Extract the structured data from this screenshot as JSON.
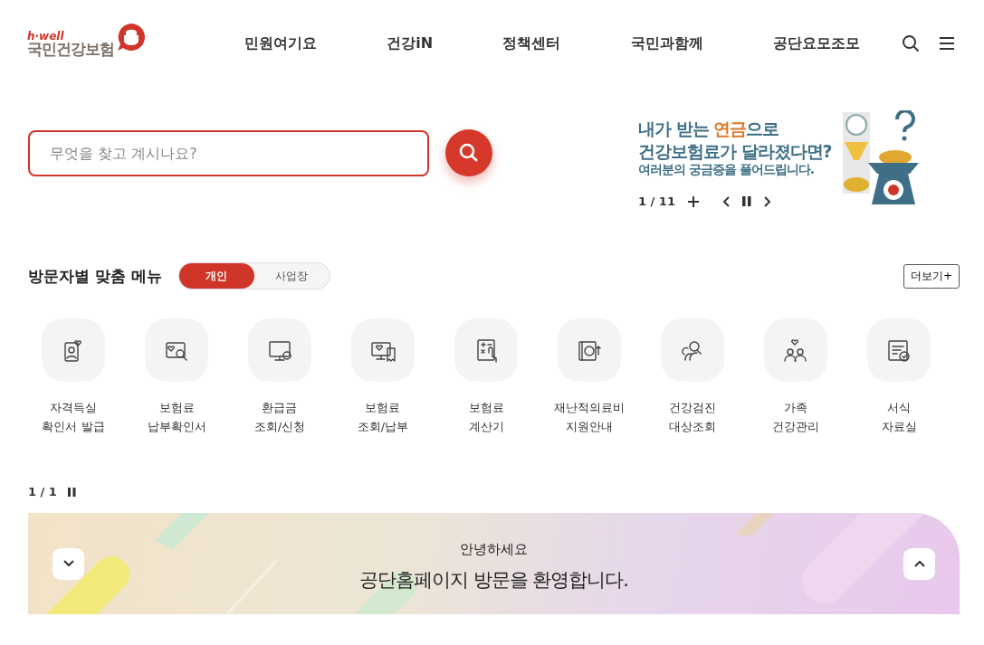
{
  "header": {
    "logo_tagline": "h·well",
    "logo_name": "국민건강보험",
    "nav": [
      {
        "label": "민원여기요"
      },
      {
        "label": "건강iN"
      },
      {
        "label": "정책센터"
      },
      {
        "label": "국민과함께"
      },
      {
        "label": "공단요모조모"
      }
    ]
  },
  "search": {
    "placeholder": "무엇을 찾고 계시나요?"
  },
  "promo": {
    "headline_1": [
      {
        "text": "내가 받는 ",
        "highlight": false
      },
      {
        "text": "연금",
        "highlight": true
      },
      {
        "text": "으로",
        "highlight": false
      }
    ],
    "headline_2": "건강보험료가 달라졌다면?",
    "subtitle": "여러분의 궁금증을 풀어드립니다.",
    "counter": "1 / 11",
    "paused": true
  },
  "menu": {
    "title": "방문자별 맞춤 메뉴",
    "tabs": [
      {
        "label": "개인",
        "selected": true
      },
      {
        "label": "사업장",
        "selected": false
      }
    ],
    "more": "더보기+",
    "items": [
      {
        "line_1": "자격득실",
        "line_2": "확인서 발급"
      },
      {
        "line_1": "보험료",
        "line_2": "납부확인서"
      },
      {
        "line_1": "환급금",
        "line_2": "조회/신청"
      },
      {
        "line_1": "보험료",
        "line_2": "조회/납부"
      },
      {
        "line_1": "보험료",
        "line_2": "계산기"
      },
      {
        "line_1": "재난적의료비",
        "line_2": "지원안내"
      },
      {
        "line_1": "건강검진",
        "line_2": "대상조회"
      },
      {
        "line_1": "가족",
        "line_2": "건강관리"
      },
      {
        "line_1": "서식",
        "line_2": "자료실"
      }
    ]
  },
  "welcome": {
    "counter": "1 / 1",
    "paused": true,
    "greeting": "안녕하세요",
    "message": "공단홈페이지 방문을 환영합니다."
  }
}
